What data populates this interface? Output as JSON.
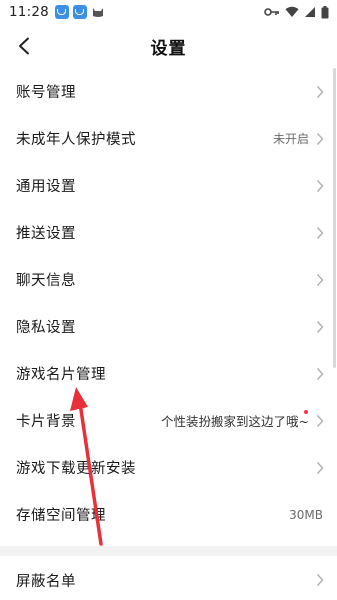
{
  "status_bar": {
    "time": "11:28",
    "icons": [
      "app-icon-1",
      "app-icon-2",
      "cat-icon",
      "key-icon",
      "wifi-icon",
      "signal-icon",
      "battery-icon"
    ]
  },
  "header": {
    "title": "设置",
    "back_icon": "chevron-left-icon"
  },
  "settings": {
    "items": [
      {
        "label": "账号管理",
        "value": "",
        "chevron": true
      },
      {
        "label": "未成年人保护模式",
        "value": "未开启",
        "chevron": true
      },
      {
        "label": "通用设置",
        "value": "",
        "chevron": true
      },
      {
        "label": "推送设置",
        "value": "",
        "chevron": true
      },
      {
        "label": "聊天信息",
        "value": "",
        "chevron": true
      },
      {
        "label": "隐私设置",
        "value": "",
        "chevron": true
      },
      {
        "label": "游戏名片管理",
        "value": "",
        "chevron": true
      },
      {
        "label": "卡片背景",
        "value": "个性装扮搬家到这边了哦~",
        "chevron": true,
        "red_dot": true
      },
      {
        "label": "游戏下载更新安装",
        "value": "",
        "chevron": true
      },
      {
        "label": "存储空间管理",
        "value": "30MB",
        "chevron": false
      }
    ],
    "section2": [
      {
        "label": "屏蔽名单",
        "value": "",
        "chevron": true
      }
    ]
  },
  "colors": {
    "annotation_arrow": "#e8303a",
    "red_dot": "#ff2e4d",
    "section_gap": "#f2f2f2"
  }
}
